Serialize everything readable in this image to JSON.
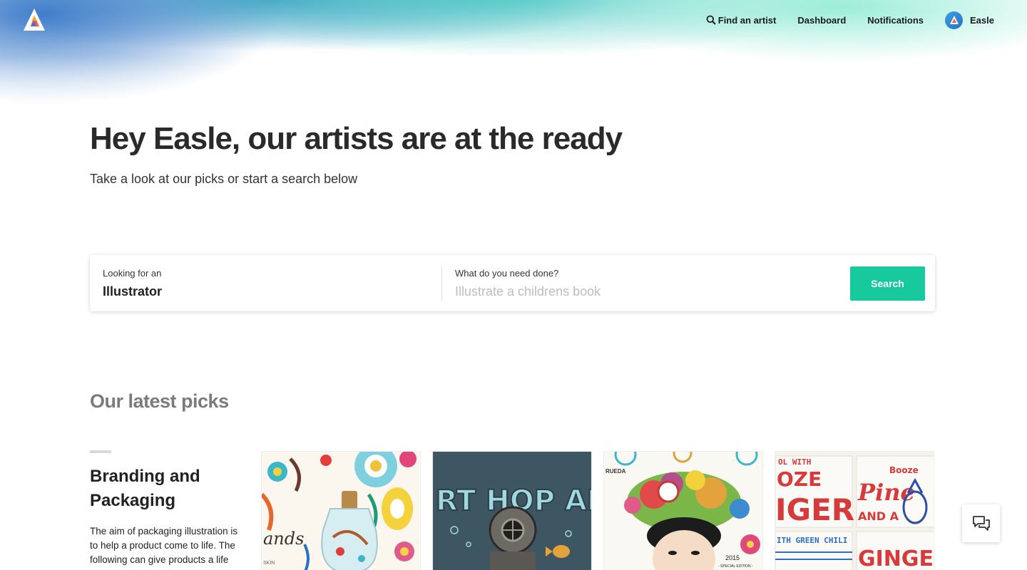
{
  "nav": {
    "find_artist": "Find an artist",
    "dashboard": "Dashboard",
    "notifications": "Notifications",
    "user_name": "Easle"
  },
  "hero": {
    "headline": "Hey Easle, our artists are at the ready",
    "subline": "Take a look at our picks or start a search below"
  },
  "search": {
    "looking_label": "Looking for an",
    "looking_value": "Illustrator",
    "need_label": "What do you need done?",
    "need_placeholder": "Illustrate a childrens book",
    "button_label": "Search"
  },
  "picks": {
    "title": "Our latest picks",
    "category_title": "Branding and Packaging",
    "category_desc": "The aim of packaging illustration is to help a product come to life. The following can give products a life",
    "items": [
      {
        "art_text": "ands",
        "art_subtext": "SKIN"
      },
      {
        "art_text": "RT HOP ALE"
      },
      {
        "art_text": "RUEDA",
        "art_subtext": "2015",
        "art_caption": "- SPECIAL EDITION -"
      },
      {
        "art_text": "OL WITH",
        "art_text_2": "OZE",
        "art_text_3": "IGER",
        "art_text_4": "ITH GREEN CHILI",
        "art_text_5": "Booze",
        "art_text_6": "Pine",
        "art_text_7": "AND A",
        "art_text_8": "GINGER,"
      }
    ]
  },
  "colors": {
    "accent": "#19c99e",
    "heading": "#2a2a2a",
    "muted_heading": "#7b7b7b"
  },
  "icons": [
    "logo-icon",
    "search-icon",
    "avatar-logo-icon",
    "chat-icon"
  ]
}
